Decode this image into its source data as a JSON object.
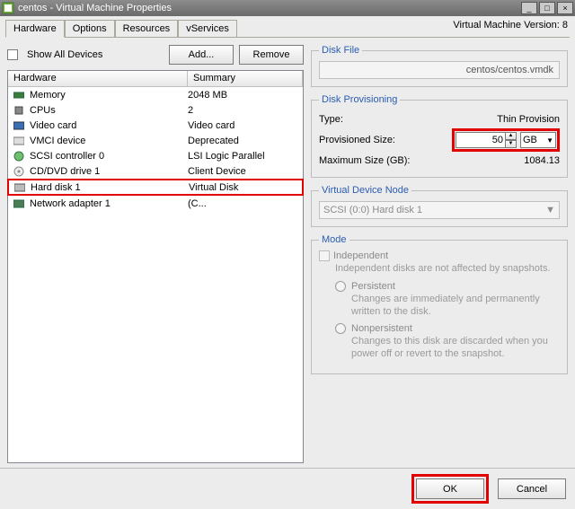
{
  "window": {
    "title": "centos - Virtual Machine Properties"
  },
  "winbuttons": {
    "min": "_",
    "max": "□",
    "close": "×"
  },
  "tabs": [
    "Hardware",
    "Options",
    "Resources",
    "vServices"
  ],
  "version_label": "Virtual Machine Version: 8",
  "toolbar": {
    "show_all": "Show All Devices",
    "add": "Add...",
    "remove": "Remove"
  },
  "list": {
    "headers": {
      "hw": "Hardware",
      "sum": "Summary"
    },
    "rows": [
      {
        "icon": "memory-icon",
        "label": "Memory",
        "summary": "2048 MB"
      },
      {
        "icon": "cpu-icon",
        "label": "CPUs",
        "summary": "2"
      },
      {
        "icon": "video-icon",
        "label": "Video card",
        "summary": "Video card"
      },
      {
        "icon": "vmci-icon",
        "label": "VMCI device",
        "summary": "Deprecated"
      },
      {
        "icon": "scsi-icon",
        "label": "SCSI controller 0",
        "summary": "LSI Logic Parallel"
      },
      {
        "icon": "cd-icon",
        "label": "CD/DVD drive 1",
        "summary": "Client Device"
      },
      {
        "icon": "disk-icon",
        "label": "Hard disk 1",
        "summary": "Virtual Disk",
        "selected": true
      },
      {
        "icon": "nic-icon",
        "label": "Network adapter 1",
        "summary": "(C..."
      }
    ]
  },
  "diskfile": {
    "legend": "Disk File",
    "value": "centos/centos.vmdk"
  },
  "provisioning": {
    "legend": "Disk Provisioning",
    "type_label": "Type:",
    "type_value": "Thin Provision",
    "size_label": "Provisioned Size:",
    "size_value": "50",
    "size_unit": "GB",
    "max_label": "Maximum Size (GB):",
    "max_value": "1084.13"
  },
  "vdn": {
    "legend": "Virtual Device Node",
    "value": "SCSI (0:0) Hard disk 1"
  },
  "mode": {
    "legend": "Mode",
    "independent": "Independent",
    "indep_desc": "Independent disks are not affected by snapshots.",
    "persistent": "Persistent",
    "persistent_desc": "Changes are immediately and permanently written to the disk.",
    "nonpersistent": "Nonpersistent",
    "nonpersistent_desc": "Changes to this disk are discarded when you power off or revert to the snapshot."
  },
  "footer": {
    "ok": "OK",
    "cancel": "Cancel"
  }
}
